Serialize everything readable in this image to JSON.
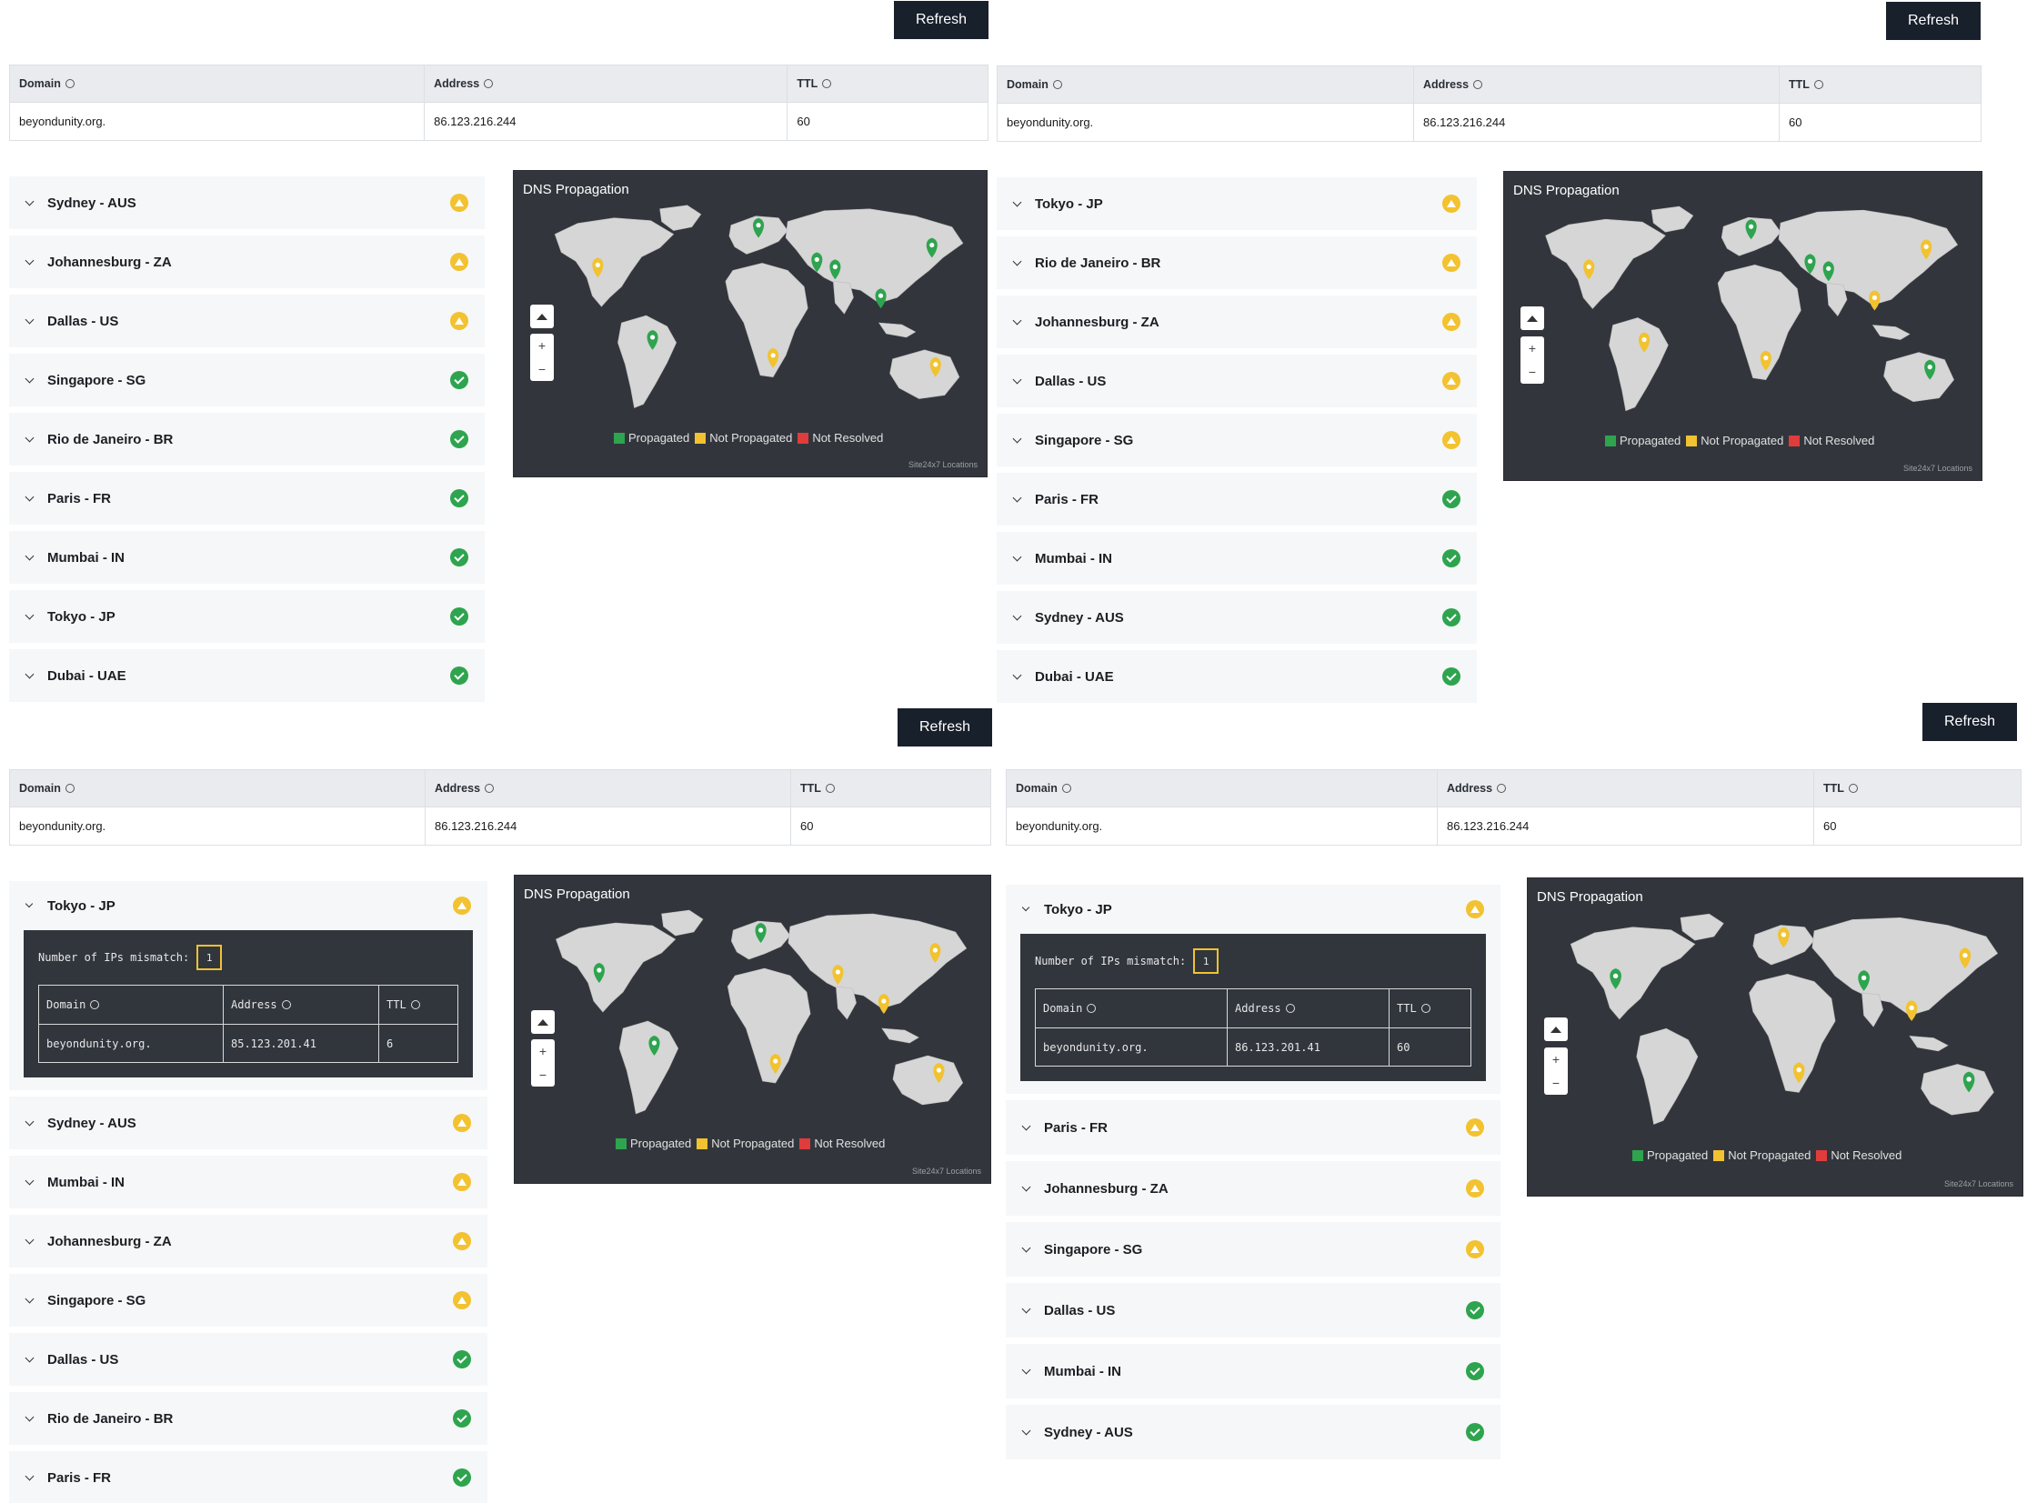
{
  "common": {
    "refresh_label": "Refresh",
    "headers": {
      "domain": "Domain",
      "address": "Address",
      "ttl": "TTL"
    },
    "record": {
      "domain": "beyondunity.org.",
      "address": "86.123.216.244",
      "ttl": "60"
    },
    "map_title": "DNS Propagation",
    "legend": {
      "propagated": "Propagated",
      "not_propagated": "Not Propagated",
      "not_resolved": "Not Resolved"
    },
    "credit": "Site24x7 Locations",
    "colors": {
      "propagated": "#2ea44f",
      "not_propagated": "#f2c230",
      "not_resolved": "#e03c3c",
      "button": "#18202c",
      "map_bg": "#32363c"
    }
  },
  "panels": [
    {
      "locations": [
        {
          "name": "Sydney - AUS",
          "status": "not_propagated"
        },
        {
          "name": "Johannesburg - ZA",
          "status": "not_propagated"
        },
        {
          "name": "Dallas - US",
          "status": "not_propagated"
        },
        {
          "name": "Singapore - SG",
          "status": "propagated"
        },
        {
          "name": "Rio de Janeiro - BR",
          "status": "propagated"
        },
        {
          "name": "Paris - FR",
          "status": "propagated"
        },
        {
          "name": "Mumbai - IN",
          "status": "propagated"
        },
        {
          "name": "Tokyo - JP",
          "status": "propagated"
        },
        {
          "name": "Dubai - UAE",
          "status": "propagated"
        }
      ]
    },
    {
      "locations": [
        {
          "name": "Tokyo - JP",
          "status": "not_propagated"
        },
        {
          "name": "Rio de Janeiro - BR",
          "status": "not_propagated"
        },
        {
          "name": "Johannesburg - ZA",
          "status": "not_propagated"
        },
        {
          "name": "Dallas - US",
          "status": "not_propagated"
        },
        {
          "name": "Singapore - SG",
          "status": "not_propagated"
        },
        {
          "name": "Paris - FR",
          "status": "propagated"
        },
        {
          "name": "Mumbai - IN",
          "status": "propagated"
        },
        {
          "name": "Sydney - AUS",
          "status": "propagated"
        },
        {
          "name": "Dubai - UAE",
          "status": "propagated"
        }
      ]
    },
    {
      "expanded": {
        "name": "Tokyo - JP",
        "status": "not_propagated",
        "mismatch_label": "Number of IPs mismatch:",
        "mismatch_count": "1",
        "row": {
          "domain": "beyondunity.org.",
          "address": "85.123.201.41",
          "ttl": "6"
        }
      },
      "locations": [
        {
          "name": "Sydney - AUS",
          "status": "not_propagated"
        },
        {
          "name": "Mumbai - IN",
          "status": "not_propagated"
        },
        {
          "name": "Johannesburg - ZA",
          "status": "not_propagated"
        },
        {
          "name": "Singapore - SG",
          "status": "not_propagated"
        },
        {
          "name": "Dallas - US",
          "status": "propagated"
        },
        {
          "name": "Rio de Janeiro - BR",
          "status": "propagated"
        },
        {
          "name": "Paris - FR",
          "status": "propagated"
        }
      ]
    },
    {
      "expanded": {
        "name": "Tokyo - JP",
        "status": "not_propagated",
        "mismatch_label": "Number of IPs mismatch:",
        "mismatch_count": "1",
        "row": {
          "domain": "beyondunity.org.",
          "address": "86.123.201.41",
          "ttl": "60"
        }
      },
      "locations": [
        {
          "name": "Paris - FR",
          "status": "not_propagated"
        },
        {
          "name": "Johannesburg - ZA",
          "status": "not_propagated"
        },
        {
          "name": "Singapore - SG",
          "status": "not_propagated"
        },
        {
          "name": "Dallas - US",
          "status": "propagated"
        },
        {
          "name": "Mumbai - IN",
          "status": "propagated"
        },
        {
          "name": "Sydney - AUS",
          "status": "propagated"
        }
      ]
    }
  ]
}
